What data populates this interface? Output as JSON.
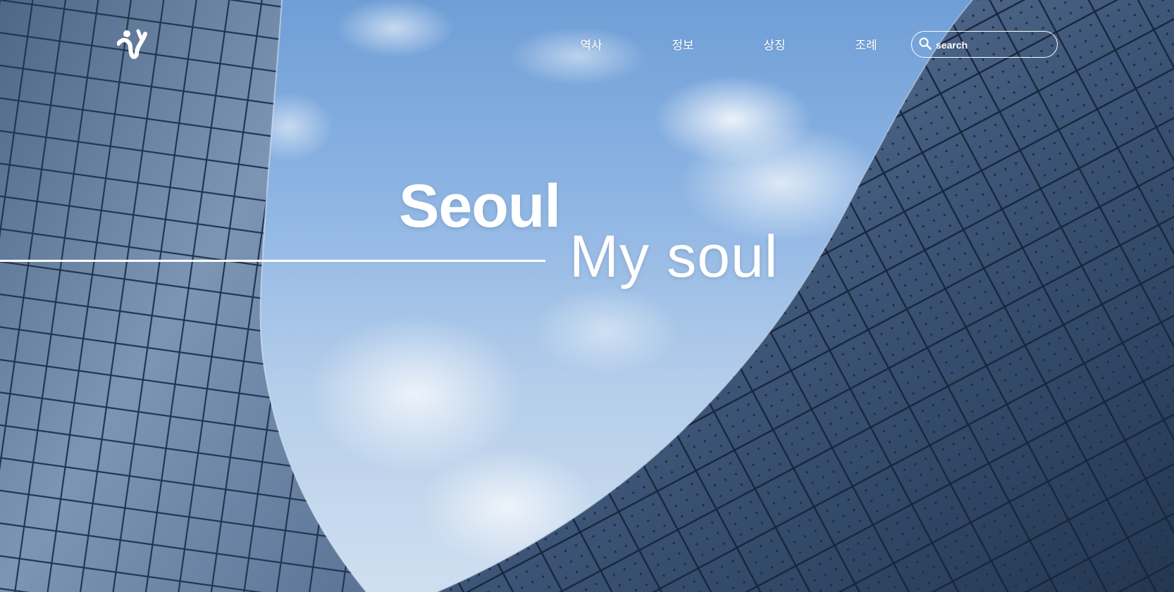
{
  "nav": {
    "items": [
      {
        "label": "역사"
      },
      {
        "label": "정보"
      },
      {
        "label": "상징"
      },
      {
        "label": "조례"
      }
    ]
  },
  "search": {
    "placeholder": "search",
    "icon": "search-icon"
  },
  "hero": {
    "title": "Seoul",
    "subtitle": "My soul"
  },
  "colors": {
    "text": "#ffffff",
    "sky": "#8fb6e4",
    "building": "#3d5475"
  }
}
